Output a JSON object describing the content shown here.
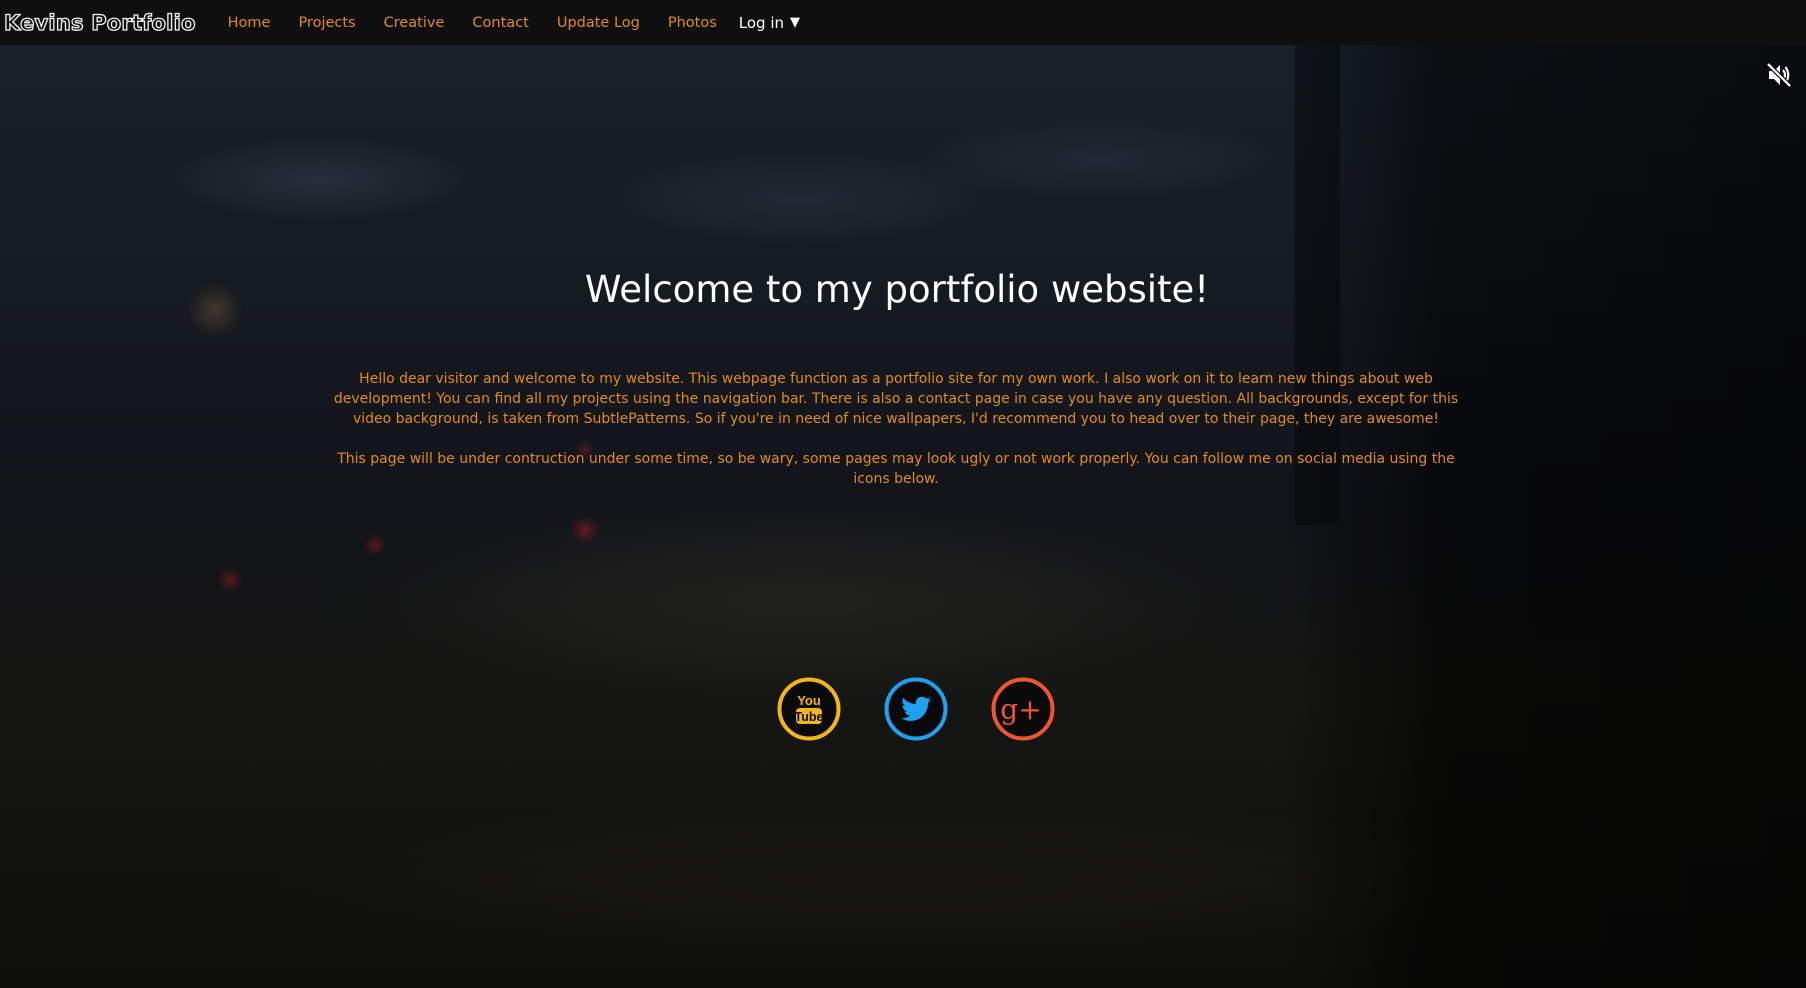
{
  "nav": {
    "brand": "Kevins Portfolio",
    "links": [
      {
        "label": "Home"
      },
      {
        "label": "Projects"
      },
      {
        "label": "Creative"
      },
      {
        "label": "Contact"
      },
      {
        "label": "Update Log"
      },
      {
        "label": "Photos"
      }
    ],
    "login_label": "Log in",
    "login_caret": "▼"
  },
  "main": {
    "title": "Welcome to my portfolio website!",
    "intro": "Hello dear visitor and welcome to my website. This webpage function as a portfolio site for my own work. I also work on it to learn new things about web development! You can find all my projects using the navigation bar. There is also a contact page in case you have any question. All backgrounds, except for this video background, is taken from SubtlePatterns. So if you're in need of nice wallpapers, I'd recommend you to head over to their page, they are awesome!",
    "notice": "This page will be under contruction under some time, so be wary, some pages may look ugly or not work properly. You can follow me on social media using the icons below."
  },
  "social": {
    "youtube": {
      "icon": "youtube-icon",
      "line1": "You",
      "line2": "Tube",
      "color": "#f2b714"
    },
    "twitter": {
      "icon": "twitter-icon",
      "color": "#1da1f2"
    },
    "googleplus": {
      "icon": "google-plus-icon",
      "label": "g+",
      "color": "#f0562e"
    }
  },
  "video": {
    "mute_icon": "volume-muted-icon"
  },
  "colors": {
    "accent": "#e28c16",
    "navbar": "#0f0f0f",
    "title": "#ffffff"
  }
}
